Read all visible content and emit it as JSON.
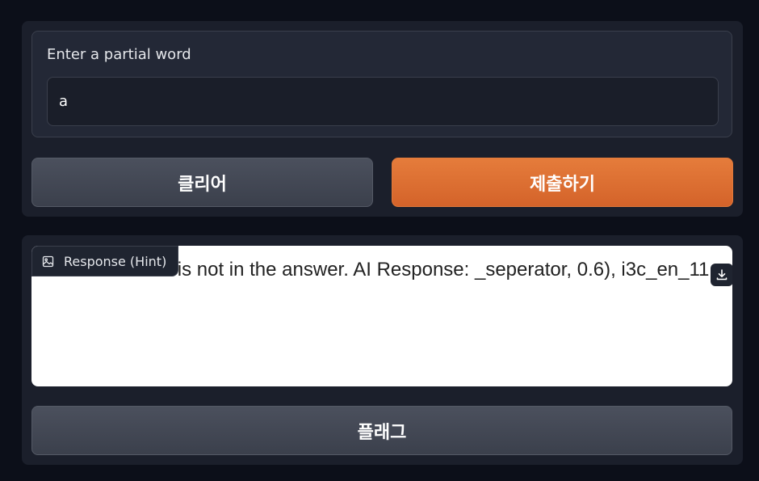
{
  "input": {
    "label": "Enter a partial word",
    "value": "a"
  },
  "buttons": {
    "clear_label": "클리어",
    "submit_label": "제출하기",
    "flag_label": "플래그"
  },
  "response": {
    "label": "Response (Hint)",
    "text": "second word a is not in the answer. AI Response: _seperator, 0.6), i3c_en_11"
  },
  "colors": {
    "background": "#0c0f19",
    "panel": "#1b1f2b",
    "primary": "#e2793a",
    "secondary": "#434854"
  },
  "icons": {
    "response_tag": "image-icon",
    "download": "download-icon"
  }
}
